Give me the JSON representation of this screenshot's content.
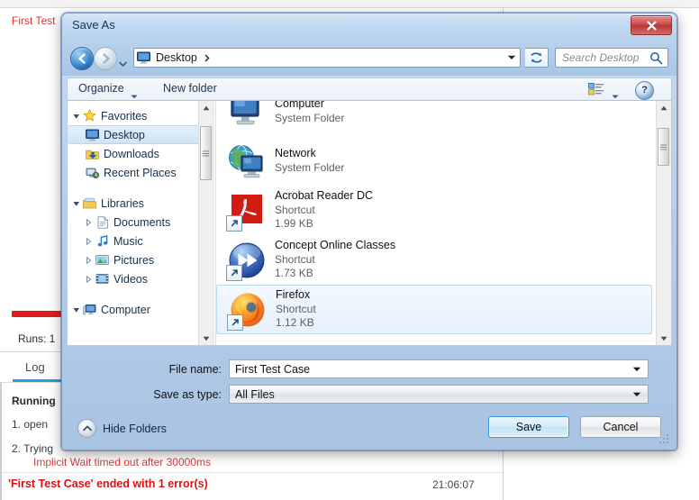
{
  "background_app": {
    "title_text": "First Test",
    "runs_text": "Runs: 1",
    "log_tab_label": "Log",
    "log_running": "Running",
    "log_step_1": "1.  open",
    "log_step_2": "2.  Trying",
    "log_error_detail": "Implicit Wait timed out after 30000ms",
    "result_text": "'First Test Case' ended with 1 error(s)",
    "timestamp": "21:06:07",
    "error_color": "#e01010",
    "accent_color": "#2d9cdb"
  },
  "dialog": {
    "title": "Save As",
    "close_label": "Close",
    "nav": {
      "back_label": "Back",
      "forward_label": "Forward",
      "history_label": "Recent pages",
      "address": "Desktop",
      "address_icon": "desktop-icon",
      "refresh_label": "Refresh",
      "search_placeholder": "Search Desktop"
    },
    "toolbar": {
      "organize_label": "Organize",
      "new_folder_label": "New folder",
      "view_label": "Change your view",
      "help_label": "Help",
      "help_glyph": "?"
    },
    "nav_pane": {
      "groups": [
        {
          "label": "Favorites",
          "icon": "star-icon",
          "expanded": true,
          "items": [
            {
              "label": "Desktop",
              "icon": "desktop-icon",
              "selected": true
            },
            {
              "label": "Downloads",
              "icon": "downloads-icon",
              "selected": false
            },
            {
              "label": "Recent Places",
              "icon": "recent-places-icon",
              "selected": false
            }
          ]
        },
        {
          "label": "Libraries",
          "icon": "libraries-icon",
          "expanded": true,
          "items": [
            {
              "label": "Documents",
              "icon": "documents-icon",
              "selected": false,
              "collapsible": true
            },
            {
              "label": "Music",
              "icon": "music-icon",
              "selected": false,
              "collapsible": true
            },
            {
              "label": "Pictures",
              "icon": "pictures-icon",
              "selected": false,
              "collapsible": true
            },
            {
              "label": "Videos",
              "icon": "videos-icon",
              "selected": false,
              "collapsible": true
            }
          ]
        },
        {
          "label": "Computer",
          "icon": "computer-icon",
          "expanded": true,
          "items": []
        }
      ]
    },
    "file_list": [
      {
        "name": "Computer",
        "type": "System Folder",
        "size": "",
        "icon": "computer-icon",
        "shortcut": false,
        "selected": false
      },
      {
        "name": "Network",
        "type": "System Folder",
        "size": "",
        "icon": "network-icon",
        "shortcut": false,
        "selected": false
      },
      {
        "name": "Acrobat Reader DC",
        "type": "Shortcut",
        "size": "1.99 KB",
        "icon": "acrobat-icon",
        "shortcut": true,
        "selected": false
      },
      {
        "name": "Concept Online Classes",
        "type": "Shortcut",
        "size": "1.73 KB",
        "icon": "media-player-icon",
        "shortcut": true,
        "selected": false
      },
      {
        "name": "Firefox",
        "type": "Shortcut",
        "size": "1.12 KB",
        "icon": "firefox-icon",
        "shortcut": true,
        "selected": true
      }
    ],
    "form": {
      "filename_label": "File name:",
      "filename_value": "First Test Case",
      "savetype_label": "Save as type:",
      "savetype_value": "All Files"
    },
    "footer": {
      "hide_folders_label": "Hide Folders",
      "save_label": "Save",
      "cancel_label": "Cancel"
    }
  }
}
